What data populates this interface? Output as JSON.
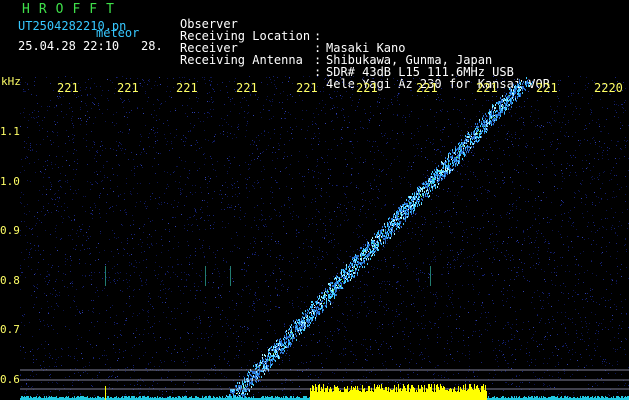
{
  "header": {
    "app_title": "HROFFT",
    "file_name": "UT2504282210.pn",
    "mode_label": "meteor",
    "timestamp": "25.04.28 22:10",
    "frame_no": "28."
  },
  "info": [
    {
      "label": "Observer",
      "value": "Masaki Kano"
    },
    {
      "label": "Receiving Location",
      "value": "Shibukawa, Gunma, Japan"
    },
    {
      "label": "Receiver",
      "value": "SDR# 43dB L15 111.6MHz USB"
    },
    {
      "label": "Receiving Antenna",
      "value": "4ele Yagi Az 230 for Kansai VOR"
    }
  ],
  "axes": {
    "unit": "kHz",
    "top_ticks": [
      "221",
      "221",
      "221",
      "221",
      "221",
      "221",
      "221",
      "221",
      "221",
      "2220"
    ],
    "left_ticks": [
      "1.1",
      "1.0",
      "0.9",
      "0.8",
      "0.7",
      "0.6"
    ]
  },
  "colors": {
    "title_green": "#3fe04a",
    "file_cyan": "#37c8ff",
    "tick_yellow": "#ffff66",
    "noise_blue": "#1a2a7a",
    "trace_cyan": "#40c8ff",
    "signal_yellow": "#ffff00"
  }
}
